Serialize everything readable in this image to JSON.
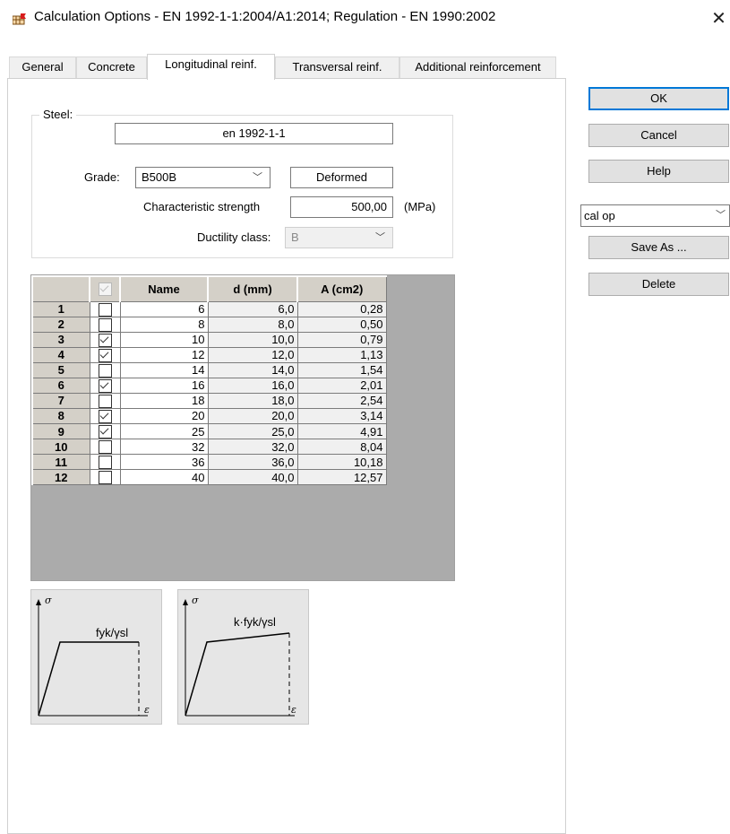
{
  "window": {
    "title": "Calculation Options - EN 1992-1-1:2004/A1:2014;  Regulation - EN 1990:2002",
    "close_glyph": "✕"
  },
  "tabs": [
    {
      "label": "General"
    },
    {
      "label": "Concrete"
    },
    {
      "label": "Longitudinal reinf."
    },
    {
      "label": "Transversal reinf."
    },
    {
      "label": "Additional reinforcement"
    }
  ],
  "steel": {
    "legend": "Steel:",
    "code": "en 1992-1-1",
    "grade_label": "Grade:",
    "grade_value": "B500B",
    "surface": "Deformed",
    "strength_label": "Characteristic strength",
    "strength_value": "500,00",
    "strength_unit": "(MPa)",
    "ductility_label": "Ductility class:",
    "ductility_value": "B"
  },
  "table": {
    "headers": [
      "",
      "",
      "Name",
      "d (mm)",
      "A (cm2)"
    ],
    "rows": [
      {
        "idx": "1",
        "checked": false,
        "name": "6",
        "d": "6,0",
        "a": "0,28"
      },
      {
        "idx": "2",
        "checked": false,
        "name": "8",
        "d": "8,0",
        "a": "0,50"
      },
      {
        "idx": "3",
        "checked": true,
        "name": "10",
        "d": "10,0",
        "a": "0,79"
      },
      {
        "idx": "4",
        "checked": true,
        "name": "12",
        "d": "12,0",
        "a": "1,13"
      },
      {
        "idx": "5",
        "checked": false,
        "name": "14",
        "d": "14,0",
        "a": "1,54"
      },
      {
        "idx": "6",
        "checked": true,
        "name": "16",
        "d": "16,0",
        "a": "2,01"
      },
      {
        "idx": "7",
        "checked": false,
        "name": "18",
        "d": "18,0",
        "a": "2,54"
      },
      {
        "idx": "8",
        "checked": true,
        "name": "20",
        "d": "20,0",
        "a": "3,14"
      },
      {
        "idx": "9",
        "checked": true,
        "name": "25",
        "d": "25,0",
        "a": "4,91"
      },
      {
        "idx": "10",
        "checked": false,
        "name": "32",
        "d": "32,0",
        "a": "8,04"
      },
      {
        "idx": "11",
        "checked": false,
        "name": "36",
        "d": "36,0",
        "a": "10,18"
      },
      {
        "idx": "12",
        "checked": false,
        "name": "40",
        "d": "40,0",
        "a": "12,57"
      }
    ]
  },
  "diagrams": [
    {
      "sigma": "σ",
      "eps": "ε",
      "label": "fyk/γsl",
      "type": "horizontal-plateau",
      "selected": true
    },
    {
      "sigma": "σ",
      "eps": "ε",
      "label": "k·fyk/γsl",
      "type": "inclined-plateau",
      "selected": false
    }
  ],
  "side": {
    "ok": "OK",
    "cancel": "Cancel",
    "help": "Help",
    "preset": "cal op",
    "save_as": "Save As ...",
    "delete": "Delete"
  },
  "colors": {
    "accent": "#0078d7",
    "tab_bg": "#f0f0f0",
    "grid_bg": "#ababab",
    "header_bg": "#d4d0c8",
    "diagram_bg": "#e6e6e6"
  }
}
